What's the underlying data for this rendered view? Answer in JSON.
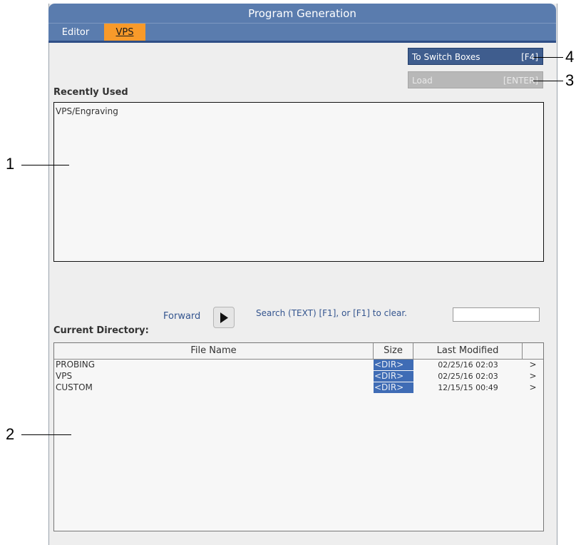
{
  "window": {
    "title": "Program Generation"
  },
  "tabs": [
    {
      "label": "Editor",
      "active": false
    },
    {
      "label": "VPS",
      "active": true
    }
  ],
  "buttons": {
    "switch_boxes": {
      "label": "To Switch Boxes",
      "key": "[F4]"
    },
    "load": {
      "label": "Load",
      "key": "[ENTER]"
    }
  },
  "recently_used": {
    "label": "Recently Used",
    "items": [
      "VPS/Engraving"
    ]
  },
  "navigation": {
    "forward_label": "Forward",
    "search_hint": "Search (TEXT) [F1], or [F1] to clear.",
    "search_value": ""
  },
  "current_directory": {
    "label": "Current Directory:",
    "columns": [
      "File Name",
      "Size",
      "Last Modified",
      ""
    ],
    "rows": [
      {
        "name": "PROBING",
        "size": "<DIR>",
        "modified": "02/25/16 02:03",
        "arrow": ">"
      },
      {
        "name": "VPS",
        "size": "<DIR>",
        "modified": "02/25/16 02:03",
        "arrow": ">"
      },
      {
        "name": "CUSTOM",
        "size": "<DIR>",
        "modified": "12/15/15 00:49",
        "arrow": ">"
      }
    ]
  },
  "callouts": [
    "1",
    "2",
    "3",
    "4"
  ],
  "colors": {
    "title_bar": "#5a7cae",
    "active_tab": "#f89a2a",
    "primary_button": "#3f5d8e",
    "size_cell": "#3f6cb5"
  }
}
